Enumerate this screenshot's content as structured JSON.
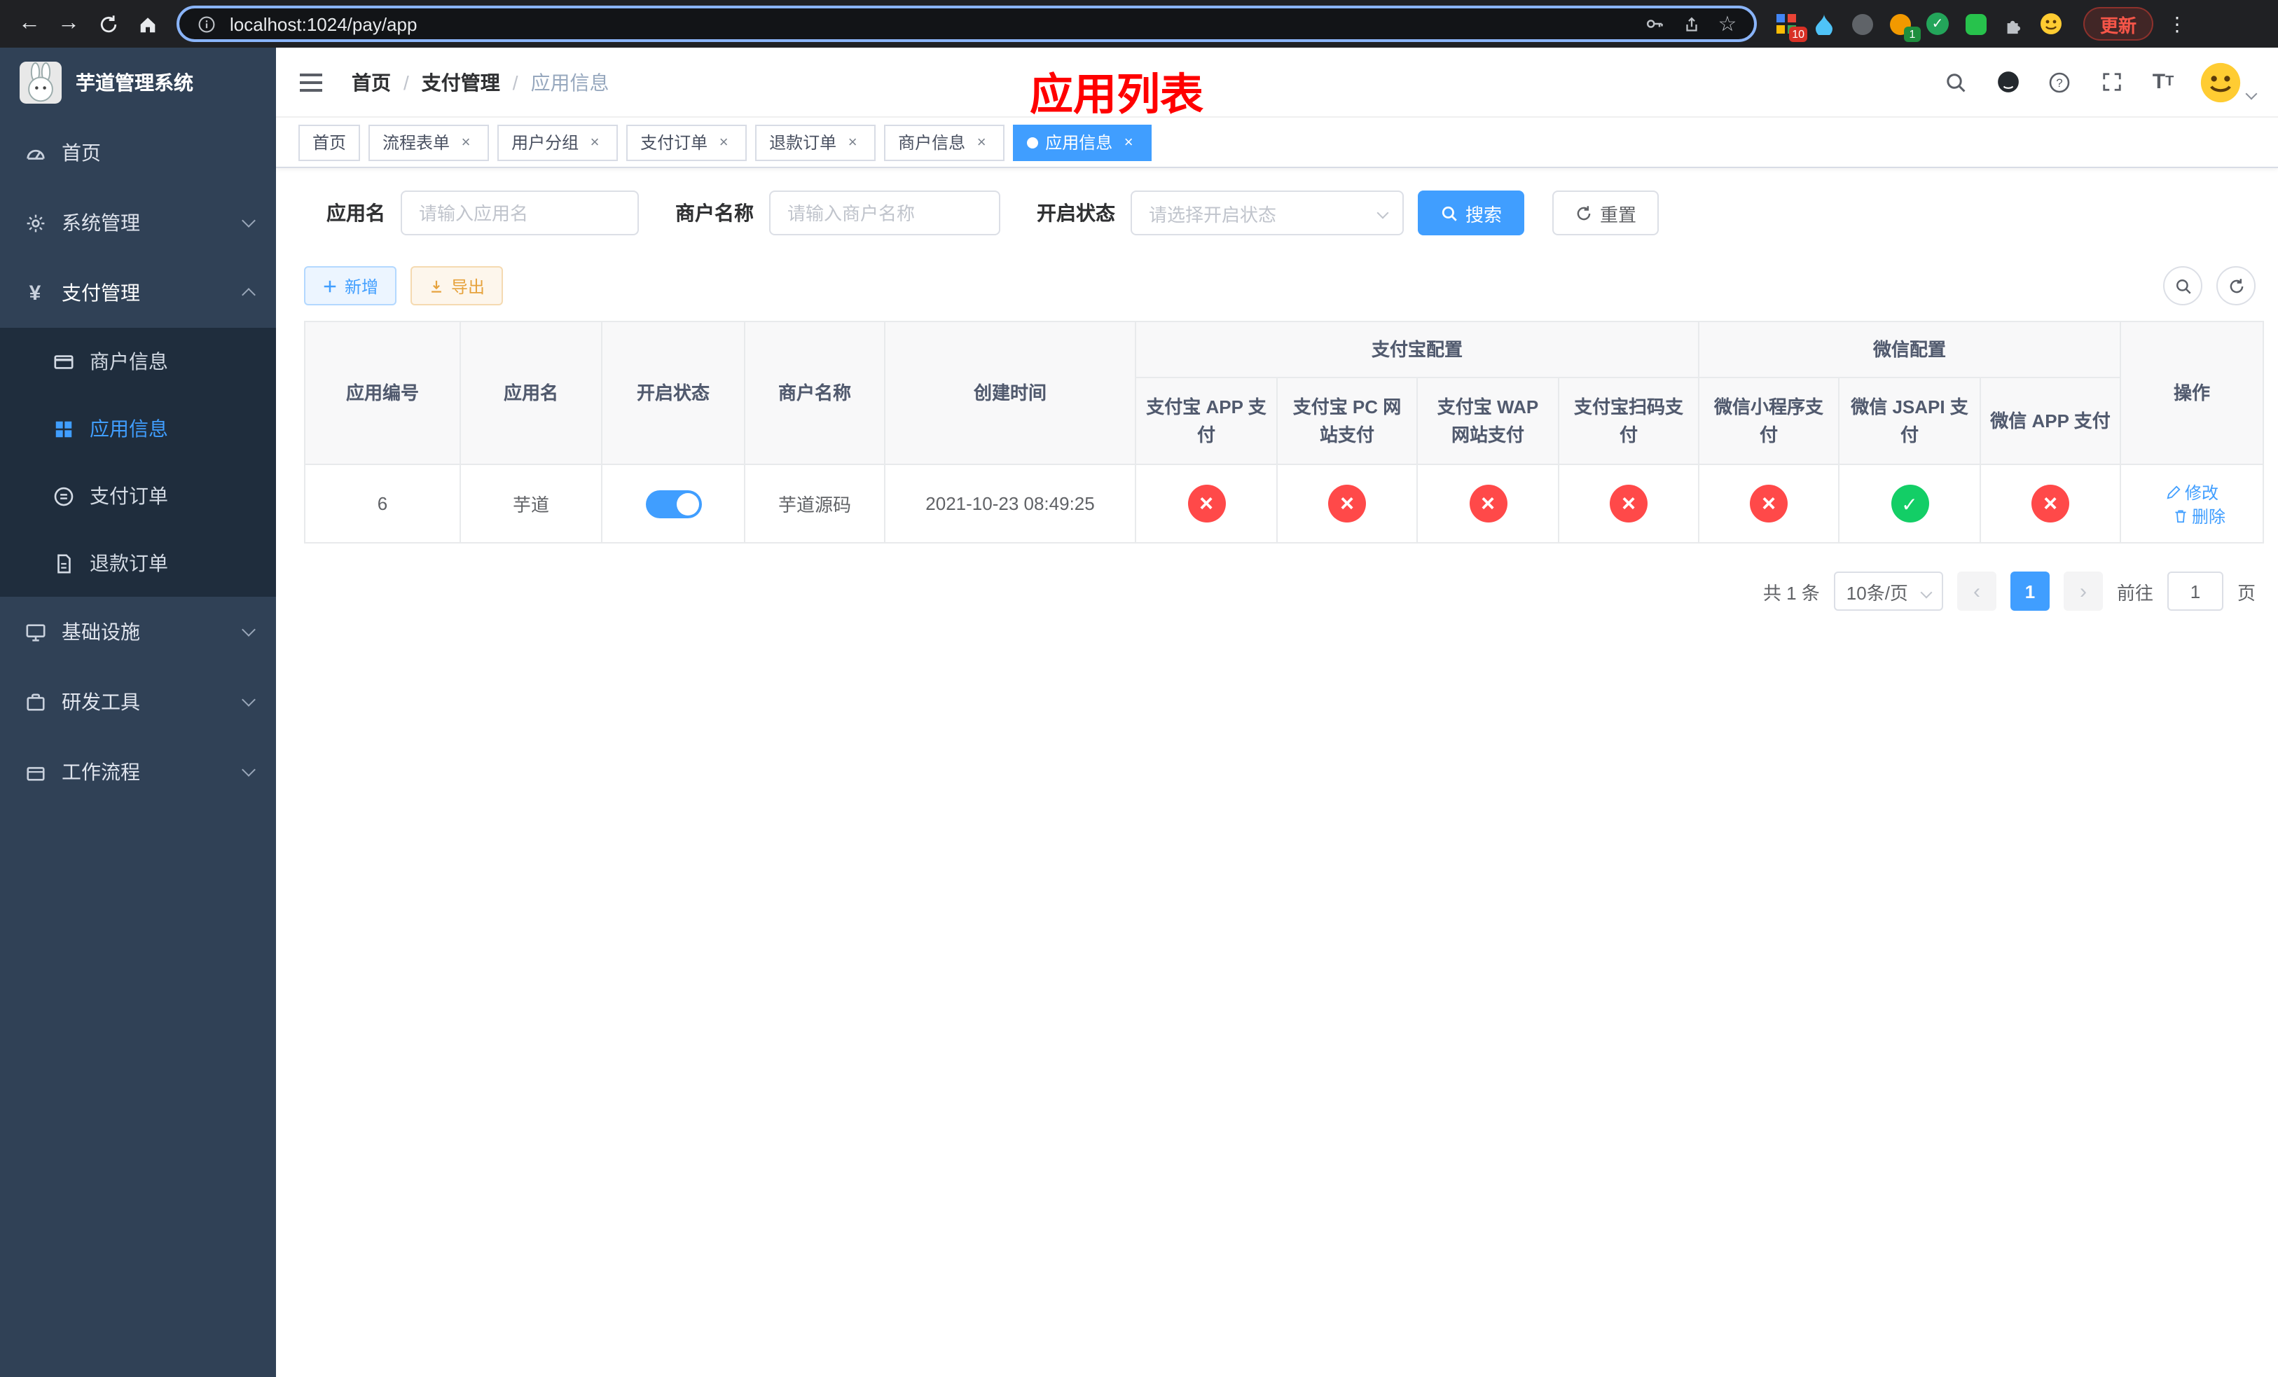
{
  "colors": {
    "accent": "#409EFF",
    "sidebar_bg": "#304156",
    "submenu_bg": "#1f2d3d",
    "danger_circle": "#ff4949",
    "success_circle": "#13ce66",
    "annotation_red": "#ff0000",
    "export_orange": "#e6a23c"
  },
  "browser": {
    "url": "localhost:1024/pay/app",
    "update_label": "更新",
    "ext_badges": {
      "grid": "10",
      "avatar": "1"
    }
  },
  "sidebar": {
    "title": "芋道管理系统",
    "menu": [
      {
        "label": "首页"
      },
      {
        "label": "系统管理"
      },
      {
        "label": "支付管理",
        "expanded": true,
        "children": [
          {
            "label": "商户信息"
          },
          {
            "label": "应用信息",
            "active": true
          },
          {
            "label": "支付订单"
          },
          {
            "label": "退款订单"
          }
        ]
      },
      {
        "label": "基础设施"
      },
      {
        "label": "研发工具"
      },
      {
        "label": "工作流程"
      }
    ]
  },
  "header": {
    "breadcrumb": [
      "首页",
      "支付管理",
      "应用信息"
    ],
    "page_title": "应用列表"
  },
  "tabs": [
    {
      "label": "首页",
      "closable": false,
      "active": false
    },
    {
      "label": "流程表单",
      "closable": true,
      "active": false
    },
    {
      "label": "用户分组",
      "closable": true,
      "active": false
    },
    {
      "label": "支付订单",
      "closable": true,
      "active": false
    },
    {
      "label": "退款订单",
      "closable": true,
      "active": false
    },
    {
      "label": "商户信息",
      "closable": true,
      "active": false
    },
    {
      "label": "应用信息",
      "closable": true,
      "active": true
    }
  ],
  "filters": {
    "app_name_label": "应用名",
    "app_name_placeholder": "请输入应用名",
    "merchant_label": "商户名称",
    "merchant_placeholder": "请输入商户名称",
    "status_label": "开启状态",
    "status_placeholder": "请选择开启状态",
    "search_label": "搜索",
    "reset_label": "重置"
  },
  "toolbar": {
    "add_label": "新增",
    "export_label": "导出"
  },
  "table": {
    "columns": {
      "id": "应用编号",
      "name": "应用名",
      "status": "开启状态",
      "merchant": "商户名称",
      "created": "创建时间",
      "op": "操作",
      "alipay_group": "支付宝配置",
      "wechat_group": "微信配置",
      "alipay_app": "支付宝 APP 支付",
      "alipay_pc": "支付宝 PC 网站支付",
      "alipay_wap": "支付宝 WAP 网站支付",
      "alipay_qr": "支付宝扫码支付",
      "wx_lite": "微信小程序支付",
      "wx_jsapi": "微信 JSAPI 支付",
      "wx_app": "微信 APP 支付"
    },
    "rows": [
      {
        "id": "6",
        "name": "芋道",
        "enabled": true,
        "merchant": "芋道源码",
        "created": "2021-10-23 08:49:25",
        "statuses": [
          false,
          false,
          false,
          false,
          false,
          true,
          false
        ],
        "edit_label": "修改",
        "delete_label": "删除"
      }
    ]
  },
  "pagination": {
    "total": "共 1 条",
    "page_size": "10条/页",
    "page": "1",
    "goto_label": "前往",
    "goto_value": "1",
    "goto_unit": "页"
  }
}
